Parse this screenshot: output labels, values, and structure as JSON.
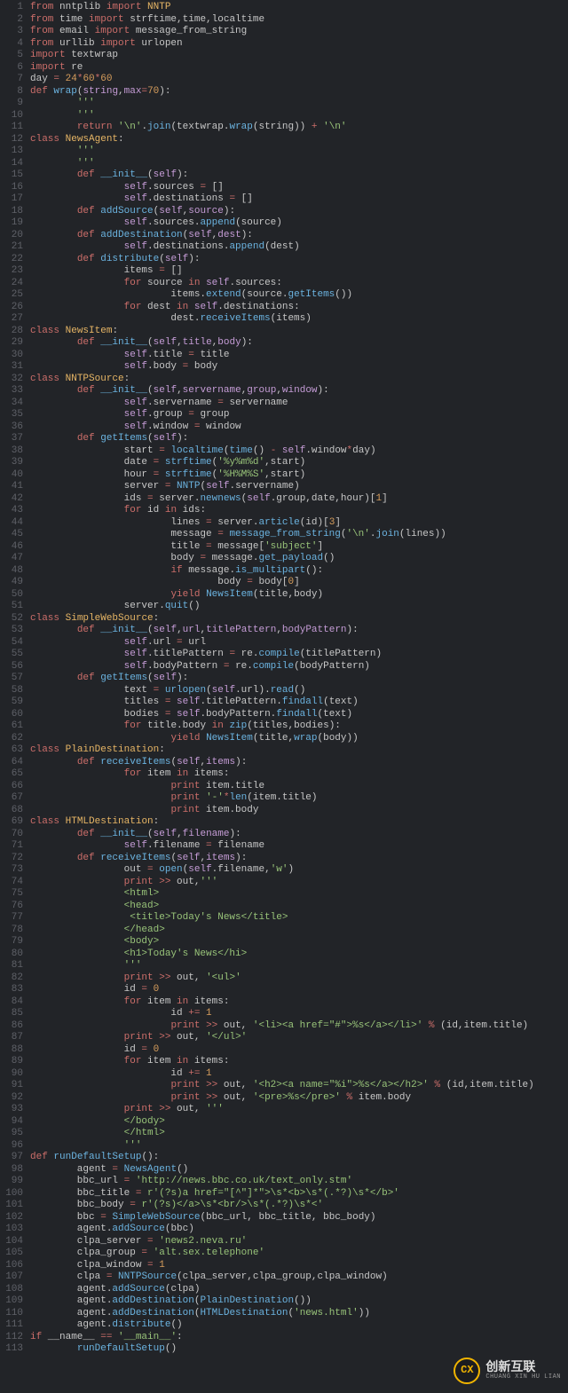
{
  "watermark": {
    "badge": "CX",
    "cn": "创新互联",
    "py": "CHUANG XIN HU LIAN"
  },
  "lines": [
    {
      "n": 1,
      "h": "<span class='kw'>from</span> nntplib <span class='kw'>import</span> <span class='nm'>NNTP</span>"
    },
    {
      "n": 2,
      "h": "<span class='kw'>from</span> time <span class='kw'>import</span> strftime,time,localtime"
    },
    {
      "n": 3,
      "h": "<span class='kw'>from</span> email <span class='kw'>import</span> message_from_string"
    },
    {
      "n": 4,
      "h": "<span class='kw'>from</span> urllib <span class='kw'>import</span> urlopen"
    },
    {
      "n": 5,
      "h": "<span class='kw'>import</span> textwrap"
    },
    {
      "n": 6,
      "h": "<span class='kw'>import</span> re"
    },
    {
      "n": 7,
      "h": "day <span class='op'>=</span> <span class='num'>24</span><span class='op'>*</span><span class='num'>60</span><span class='op'>*</span><span class='num'>60</span>"
    },
    {
      "n": 8,
      "h": "<span class='kw'>def</span> <span class='fn'>wrap</span>(<span class='self'>string</span>,<span class='self'>max</span><span class='op'>=</span><span class='num'>70</span>):"
    },
    {
      "n": 9,
      "h": "        <span class='str'>'''</span>"
    },
    {
      "n": 10,
      "h": "<span class='str'>        '''</span>"
    },
    {
      "n": 11,
      "h": "        <span class='kw'>return</span> <span class='str'>'\\n'</span>.<span class='fn'>join</span>(textwrap.<span class='fn'>wrap</span>(string)) <span class='op'>+</span> <span class='str'>'\\n'</span>"
    },
    {
      "n": 12,
      "h": "<span class='kw'>class</span> <span class='nm'>NewsAgent</span>:"
    },
    {
      "n": 13,
      "h": "        <span class='str'>'''</span>"
    },
    {
      "n": 14,
      "h": "<span class='str'>        '''</span>"
    },
    {
      "n": 15,
      "h": "        <span class='kw'>def</span> <span class='fn'>__init__</span>(<span class='self'>self</span>):"
    },
    {
      "n": 16,
      "h": "                <span class='self'>self</span>.sources <span class='op'>=</span> []"
    },
    {
      "n": 17,
      "h": "                <span class='self'>self</span>.destinations <span class='op'>=</span> []"
    },
    {
      "n": 18,
      "h": "        <span class='kw'>def</span> <span class='fn'>addSource</span>(<span class='self'>self</span>,<span class='self'>source</span>):"
    },
    {
      "n": 19,
      "h": "                <span class='self'>self</span>.sources.<span class='fn'>append</span>(source)"
    },
    {
      "n": 20,
      "h": "        <span class='kw'>def</span> <span class='fn'>addDestination</span>(<span class='self'>self</span>,<span class='self'>dest</span>):"
    },
    {
      "n": 21,
      "h": "                <span class='self'>self</span>.destinations.<span class='fn'>append</span>(dest)"
    },
    {
      "n": 22,
      "h": "        <span class='kw'>def</span> <span class='fn'>distribute</span>(<span class='self'>self</span>):"
    },
    {
      "n": 23,
      "h": "                items <span class='op'>=</span> []"
    },
    {
      "n": 24,
      "h": "                <span class='kw'>for</span> source <span class='kw'>in</span> <span class='self'>self</span>.sources:"
    },
    {
      "n": 25,
      "h": "                        items.<span class='fn'>extend</span>(source.<span class='fn'>getItems</span>())"
    },
    {
      "n": 26,
      "h": "                <span class='kw'>for</span> dest <span class='kw'>in</span> <span class='self'>self</span>.destinations:"
    },
    {
      "n": 27,
      "h": "                        dest.<span class='fn'>receiveItems</span>(items)"
    },
    {
      "n": 28,
      "h": "<span class='kw'>class</span> <span class='nm'>NewsItem</span>:"
    },
    {
      "n": 29,
      "h": "        <span class='kw'>def</span> <span class='fn'>__init__</span>(<span class='self'>self</span>,<span class='self'>title</span>,<span class='self'>body</span>):"
    },
    {
      "n": 30,
      "h": "                <span class='self'>self</span>.title <span class='op'>=</span> title"
    },
    {
      "n": 31,
      "h": "                <span class='self'>self</span>.body <span class='op'>=</span> body"
    },
    {
      "n": 32,
      "h": "<span class='kw'>class</span> <span class='nm'>NNTPSource</span>:"
    },
    {
      "n": 33,
      "h": "        <span class='kw'>def</span> <span class='fn'>__init__</span>(<span class='self'>self</span>,<span class='self'>servername</span>,<span class='self'>group</span>,<span class='self'>window</span>):"
    },
    {
      "n": 34,
      "h": "                <span class='self'>self</span>.servername <span class='op'>=</span> servername"
    },
    {
      "n": 35,
      "h": "                <span class='self'>self</span>.group <span class='op'>=</span> group"
    },
    {
      "n": 36,
      "h": "                <span class='self'>self</span>.window <span class='op'>=</span> window"
    },
    {
      "n": 37,
      "h": "        <span class='kw'>def</span> <span class='fn'>getItems</span>(<span class='self'>self</span>):"
    },
    {
      "n": 38,
      "h": "                start <span class='op'>=</span> <span class='fn'>localtime</span>(<span class='fn'>time</span>() <span class='op'>-</span> <span class='self'>self</span>.window<span class='op'>*</span>day)"
    },
    {
      "n": 39,
      "h": "                date <span class='op'>=</span> <span class='fn'>strftime</span>(<span class='str'>'%y%m%d'</span>,start)"
    },
    {
      "n": 40,
      "h": "                hour <span class='op'>=</span> <span class='fn'>strftime</span>(<span class='str'>'%H%M%S'</span>,start)"
    },
    {
      "n": 41,
      "h": "                server <span class='op'>=</span> <span class='fn'>NNTP</span>(<span class='self'>self</span>.servername)"
    },
    {
      "n": 42,
      "h": "                ids <span class='op'>=</span> server.<span class='fn'>newnews</span>(<span class='self'>self</span>.group,date,hour)[<span class='num'>1</span>]"
    },
    {
      "n": 43,
      "h": "                <span class='kw'>for</span> id <span class='kw'>in</span> ids:"
    },
    {
      "n": 44,
      "h": "                        lines <span class='op'>=</span> server.<span class='fn'>article</span>(id)[<span class='num'>3</span>]"
    },
    {
      "n": 45,
      "h": "                        message <span class='op'>=</span> <span class='fn'>message_from_string</span>(<span class='str'>'\\n'</span>.<span class='fn'>join</span>(lines))"
    },
    {
      "n": 46,
      "h": "                        title <span class='op'>=</span> message[<span class='str'>'subject'</span>]"
    },
    {
      "n": 47,
      "h": "                        body <span class='op'>=</span> message.<span class='fn'>get_payload</span>()"
    },
    {
      "n": 48,
      "h": "                        <span class='kw'>if</span> message.<span class='fn'>is_multipart</span>():"
    },
    {
      "n": 49,
      "h": "                                body <span class='op'>=</span> body[<span class='num'>0</span>]"
    },
    {
      "n": 50,
      "h": "                        <span class='kw'>yield</span> <span class='fn'>NewsItem</span>(title,body)"
    },
    {
      "n": 51,
      "h": "                server.<span class='fn'>quit</span>()"
    },
    {
      "n": 52,
      "h": "<span class='kw'>class</span> <span class='nm'>SimpleWebSource</span>:"
    },
    {
      "n": 53,
      "h": "        <span class='kw'>def</span> <span class='fn'>__init__</span>(<span class='self'>self</span>,<span class='self'>url</span>,<span class='self'>titlePattern</span>,<span class='self'>bodyPattern</span>):"
    },
    {
      "n": 54,
      "h": "                <span class='self'>self</span>.url <span class='op'>=</span> url"
    },
    {
      "n": 55,
      "h": "                <span class='self'>self</span>.titlePattern <span class='op'>=</span> re.<span class='fn'>compile</span>(titlePattern)"
    },
    {
      "n": 56,
      "h": "                <span class='self'>self</span>.bodyPattern <span class='op'>=</span> re.<span class='fn'>compile</span>(bodyPattern)"
    },
    {
      "n": 57,
      "h": "        <span class='kw'>def</span> <span class='fn'>getItems</span>(<span class='self'>self</span>):"
    },
    {
      "n": 58,
      "h": "                text <span class='op'>=</span> <span class='fn'>urlopen</span>(<span class='self'>self</span>.url).<span class='fn'>read</span>()"
    },
    {
      "n": 59,
      "h": "                titles <span class='op'>=</span> <span class='self'>self</span>.titlePattern.<span class='fn'>findall</span>(text)"
    },
    {
      "n": 60,
      "h": "                bodies <span class='op'>=</span> <span class='self'>self</span>.bodyPattern.<span class='fn'>findall</span>(text)"
    },
    {
      "n": 61,
      "h": "                <span class='kw'>for</span> title.body <span class='kw'>in</span> <span class='fn'>zip</span>(titles,bodies):"
    },
    {
      "n": 62,
      "h": "                        <span class='kw'>yield</span> <span class='fn'>NewsItem</span>(title,<span class='fn'>wrap</span>(body))"
    },
    {
      "n": 63,
      "h": "<span class='kw'>class</span> <span class='nm'>PlainDestination</span>:"
    },
    {
      "n": 64,
      "h": "        <span class='kw'>def</span> <span class='fn'>receiveItems</span>(<span class='self'>self</span>,<span class='self'>items</span>):"
    },
    {
      "n": 65,
      "h": "                <span class='kw'>for</span> item <span class='kw'>in</span> items:"
    },
    {
      "n": 66,
      "h": "                        <span class='kw'>print</span> item.title"
    },
    {
      "n": 67,
      "h": "                        <span class='kw'>print</span> <span class='str'>'-'</span><span class='op'>*</span><span class='fn'>len</span>(item.title)"
    },
    {
      "n": 68,
      "h": "                        <span class='kw'>print</span> item.body"
    },
    {
      "n": 69,
      "h": "<span class='kw'>class</span> <span class='nm'>HTMLDestination</span>:"
    },
    {
      "n": 70,
      "h": "        <span class='kw'>def</span> <span class='fn'>__init__</span>(<span class='self'>self</span>,<span class='self'>filename</span>):"
    },
    {
      "n": 71,
      "h": "                <span class='self'>self</span>.filename <span class='op'>=</span> filename"
    },
    {
      "n": 72,
      "h": "        <span class='kw'>def</span> <span class='fn'>receiveItems</span>(<span class='self'>self</span>,<span class='self'>items</span>):"
    },
    {
      "n": 73,
      "h": "                out <span class='op'>=</span> <span class='fn'>open</span>(<span class='self'>self</span>.filename,<span class='str'>'w'</span>)"
    },
    {
      "n": 74,
      "h": "                <span class='kw'>print</span> <span class='op'>&gt;&gt;</span> out,<span class='str'>'''</span>"
    },
    {
      "n": 75,
      "h": "<span class='str'>                &lt;html&gt;</span>"
    },
    {
      "n": 76,
      "h": "<span class='str'>                &lt;head&gt;</span>"
    },
    {
      "n": 77,
      "h": "<span class='str'>                 &lt;title&gt;Today's News&lt;/title&gt;</span>"
    },
    {
      "n": 78,
      "h": "<span class='str'>                &lt;/head&gt;</span>"
    },
    {
      "n": 79,
      "h": "<span class='str'>                &lt;body&gt;</span>"
    },
    {
      "n": 80,
      "h": "<span class='str'>                &lt;h1&gt;Today's News&lt;/hi&gt;</span>"
    },
    {
      "n": 81,
      "h": "<span class='str'>                '''</span>"
    },
    {
      "n": 82,
      "h": "                <span class='kw'>print</span> <span class='op'>&gt;&gt;</span> out, <span class='str'>'&lt;ul&gt;'</span>"
    },
    {
      "n": 83,
      "h": "                id <span class='op'>=</span> <span class='num'>0</span>"
    },
    {
      "n": 84,
      "h": "                <span class='kw'>for</span> item <span class='kw'>in</span> items:"
    },
    {
      "n": 85,
      "h": "                        id <span class='op'>+=</span> <span class='num'>1</span>"
    },
    {
      "n": 86,
      "h": "                        <span class='kw'>print</span> <span class='op'>&gt;&gt;</span> out, <span class='str'>'&lt;li&gt;&lt;a href=\"#\"&gt;%s&lt;/a&gt;&lt;/li&gt;'</span> <span class='op'>%</span> (id,item.title)"
    },
    {
      "n": 87,
      "h": "                <span class='kw'>print</span> <span class='op'>&gt;&gt;</span> out, <span class='str'>'&lt;/ul&gt;'</span>"
    },
    {
      "n": 88,
      "h": "                id <span class='op'>=</span> <span class='num'>0</span>"
    },
    {
      "n": 89,
      "h": "                <span class='kw'>for</span> item <span class='kw'>in</span> items:"
    },
    {
      "n": 90,
      "h": "                        id <span class='op'>+=</span> <span class='num'>1</span>"
    },
    {
      "n": 91,
      "h": "                        <span class='kw'>print</span> <span class='op'>&gt;&gt;</span> out, <span class='str'>'&lt;h2&gt;&lt;a name=\"%i\"&gt;%s&lt;/a&gt;&lt;/h2&gt;'</span> <span class='op'>%</span> (id,item.title)"
    },
    {
      "n": 92,
      "h": "                        <span class='kw'>print</span> <span class='op'>&gt;&gt;</span> out, <span class='str'>'&lt;pre&gt;%s&lt;/pre&gt;'</span> <span class='op'>%</span> item.body"
    },
    {
      "n": 93,
      "h": "                <span class='kw'>print</span> <span class='op'>&gt;&gt;</span> out, <span class='str'>'''</span>"
    },
    {
      "n": 94,
      "h": "<span class='str'>                &lt;/body&gt;</span>"
    },
    {
      "n": 95,
      "h": "<span class='str'>                &lt;/html&gt;</span>"
    },
    {
      "n": 96,
      "h": "<span class='str'>                '''</span>"
    },
    {
      "n": 97,
      "h": "<span class='kw'>def</span> <span class='fn'>runDefaultSetup</span>():"
    },
    {
      "n": 98,
      "h": "        agent <span class='op'>=</span> <span class='fn'>NewsAgent</span>()"
    },
    {
      "n": 99,
      "h": "        bbc_url <span class='op'>=</span> <span class='str'>'http://news.bbc.co.uk/text_only.stm'</span>"
    },
    {
      "n": 100,
      "h": "        bbc_title <span class='op'>=</span> <span class='str'>r'(?s)a href=\"[^\"]*\"&gt;\\s*&lt;b&gt;\\s*(.*?)\\s*&lt;/b&gt;'</span>"
    },
    {
      "n": 101,
      "h": "        bbc_body <span class='op'>=</span> <span class='str'>r'(?s)&lt;/a&gt;\\s*&lt;br/&gt;\\s*(.*?)\\s*&lt;'</span>"
    },
    {
      "n": 102,
      "h": "        bbc <span class='op'>=</span> <span class='fn'>SimpleWebSource</span>(bbc_url, bbc_title, bbc_body)"
    },
    {
      "n": 103,
      "h": "        agent.<span class='fn'>addSource</span>(bbc)"
    },
    {
      "n": 104,
      "h": "        clpa_server <span class='op'>=</span> <span class='str'>'news2.neva.ru'</span>"
    },
    {
      "n": 105,
      "h": "        clpa_group <span class='op'>=</span> <span class='str'>'alt.sex.telephone'</span>"
    },
    {
      "n": 106,
      "h": "        clpa_window <span class='op'>=</span> <span class='num'>1</span>"
    },
    {
      "n": 107,
      "h": "        clpa <span class='op'>=</span> <span class='fn'>NNTPSource</span>(clpa_server,clpa_group,clpa_window)"
    },
    {
      "n": 108,
      "h": "        agent.<span class='fn'>addSource</span>(clpa)"
    },
    {
      "n": 109,
      "h": "        agent.<span class='fn'>addDestination</span>(<span class='fn'>PlainDestination</span>())"
    },
    {
      "n": 110,
      "h": "        agent.<span class='fn'>addDestination</span>(<span class='fn'>HTMLDestination</span>(<span class='str'>'news.html'</span>))"
    },
    {
      "n": 111,
      "h": "        agent.<span class='fn'>distribute</span>()"
    },
    {
      "n": 112,
      "h": "<span class='kw'>if</span> __name__ <span class='op'>==</span> <span class='str'>'__main__'</span>:"
    },
    {
      "n": 113,
      "h": "        <span class='fn'>runDefaultSetup</span>()"
    }
  ]
}
